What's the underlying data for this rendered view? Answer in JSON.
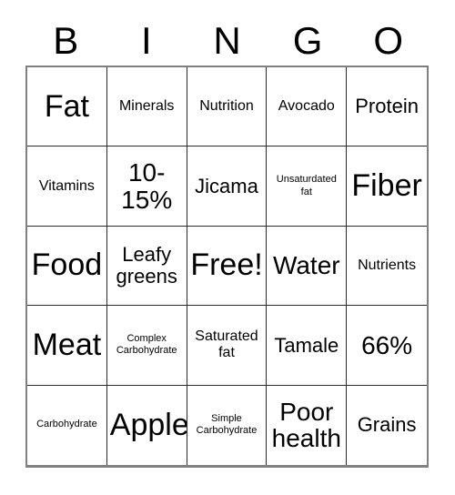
{
  "card": {
    "title": "BINGO",
    "header_letters": [
      "B",
      "I",
      "N",
      "G",
      "O"
    ],
    "grid_size": "5x5",
    "colors": {
      "background": "#ffffff",
      "text": "#000000",
      "inner_border": "#2b2b2b",
      "outer_border": "#808080"
    },
    "rows": [
      {
        "cells": [
          {
            "text": "Fat",
            "size": "fs-xl"
          },
          {
            "text": "Minerals",
            "size": "fs-sm"
          },
          {
            "text": "Nutrition",
            "size": "fs-sm"
          },
          {
            "text": "Avocado",
            "size": "fs-sm"
          },
          {
            "text": "Protein",
            "size": "fs-md"
          }
        ]
      },
      {
        "cells": [
          {
            "text": "Vitamins",
            "size": "fs-sm"
          },
          {
            "text": "10-\n15%",
            "size": "fs-lg"
          },
          {
            "text": "Jicama",
            "size": "fs-md"
          },
          {
            "text": "Unsaturdated\nfat",
            "size": "fs-xs"
          },
          {
            "text": "Fiber",
            "size": "fs-xl"
          }
        ]
      },
      {
        "cells": [
          {
            "text": "Food",
            "size": "fs-xl"
          },
          {
            "text": "Leafy\ngreens",
            "size": "fs-md"
          },
          {
            "text": "Free!",
            "size": "fs-xl"
          },
          {
            "text": "Water",
            "size": "fs-lg"
          },
          {
            "text": "Nutrients",
            "size": "fs-sm"
          }
        ]
      },
      {
        "cells": [
          {
            "text": "Meat",
            "size": "fs-xl"
          },
          {
            "text": "Complex\nCarbohydrate",
            "size": "fs-xs"
          },
          {
            "text": "Saturated\nfat",
            "size": "fs-sm"
          },
          {
            "text": "Tamale",
            "size": "fs-md"
          },
          {
            "text": "66%",
            "size": "fs-lg"
          }
        ]
      },
      {
        "cells": [
          {
            "text": "Carbohydrate",
            "size": "fs-xs"
          },
          {
            "text": "Apple",
            "size": "fs-xl"
          },
          {
            "text": "Simple\nCarbohydrate",
            "size": "fs-xs"
          },
          {
            "text": "Poor\nhealth",
            "size": "fs-lg"
          },
          {
            "text": "Grains",
            "size": "fs-md"
          }
        ]
      }
    ]
  }
}
